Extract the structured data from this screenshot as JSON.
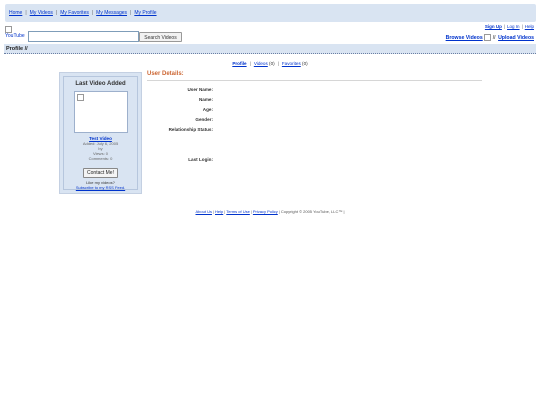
{
  "top_nav": [
    "Home",
    "My Videos",
    "My Favorites",
    "My Messages",
    "My Profile"
  ],
  "logo": {
    "alt": "YouTube"
  },
  "search": {
    "value": "",
    "button": "Search Videos"
  },
  "account_links": {
    "sign_up": "Sign Up",
    "log_in": "Log In",
    "help": "Help"
  },
  "browse_links": {
    "browse": "Browse Videos",
    "sep": "//",
    "upload": "Upload Videos"
  },
  "profile_bar": {
    "title": "Profile //"
  },
  "profile_tabs": [
    {
      "label": "Profile",
      "bold": true,
      "suffix": ""
    },
    {
      "label": "Videos",
      "bold": false,
      "suffix": " (0)"
    },
    {
      "label": "Favorites",
      "bold": false,
      "suffix": " (0)"
    }
  ],
  "last_video": {
    "heading": "Last Video Added",
    "title": "Test Video",
    "added": "Added: July 6, 2005",
    "by": "by",
    "views": "Views: 0",
    "comments": "Comments: 0",
    "contact_button": "Contact Me!",
    "like_text": "Like my videos?",
    "rss_link": "Subscribe to my RSS Feed."
  },
  "user_details": {
    "heading": "User Details:",
    "fields": [
      "User Name:",
      "Name:",
      "Age:",
      "Gender:",
      "Relationship Status:",
      "Last Login:"
    ]
  },
  "footer": {
    "links": [
      "About Us",
      "Help",
      "Terms of Use",
      "Privacy Policy"
    ],
    "copyright": "Copyright © 2005 YouTube, LLC™ |"
  }
}
